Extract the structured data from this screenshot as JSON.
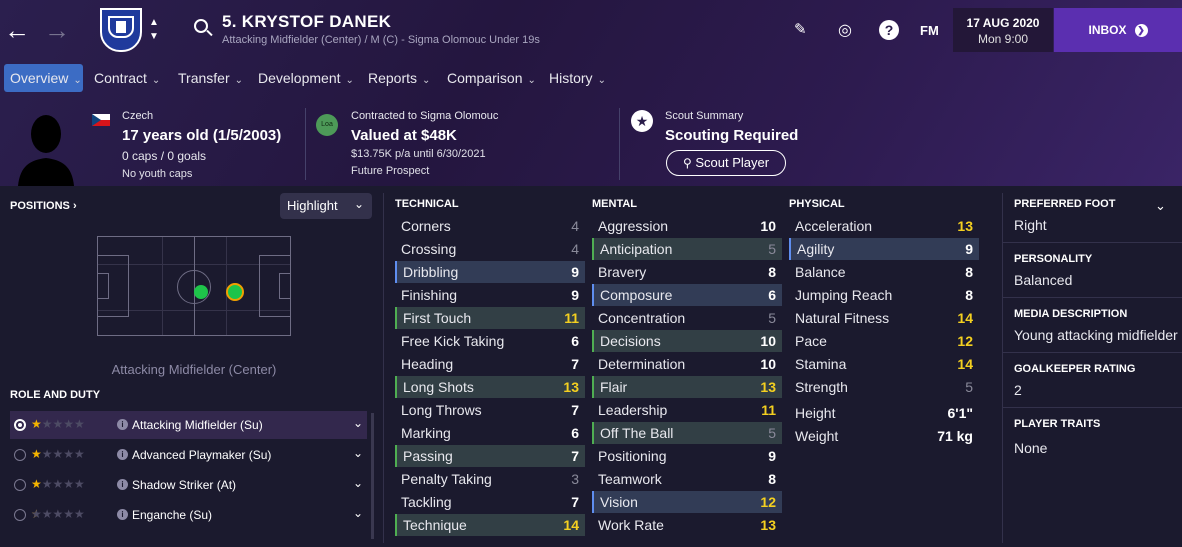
{
  "header": {
    "player_name": "5. KRYSTOF DANEK",
    "player_sub": "Attacking Midfielder (Center) / M (C) - Sigma Olomouc Under 19s",
    "brand": "FM",
    "date": "17 AUG 2020",
    "time": "Mon 9:00",
    "inbox_label": "INBOX"
  },
  "tabs": [
    {
      "label": "Overview"
    },
    {
      "label": "Contract"
    },
    {
      "label": "Transfer"
    },
    {
      "label": "Development"
    },
    {
      "label": "Reports"
    },
    {
      "label": "Comparison"
    },
    {
      "label": "History"
    }
  ],
  "profile": {
    "nationality": "Czech",
    "age": "17 years old (1/5/2003)",
    "caps": "0 caps / 0 goals",
    "youth_caps": "No youth caps"
  },
  "contract": {
    "club_badge": "Loa",
    "line1": "Contracted to Sigma Olomouc",
    "value": "Valued at $48K",
    "wage": "$13.75K p/a until 6/30/2021",
    "status": "Future Prospect"
  },
  "scout": {
    "title": "Scout Summary",
    "status": "Scouting Required",
    "button": "Scout Player"
  },
  "positions": {
    "title": "POSITIONS",
    "highlight": "Highlight",
    "label": "Attacking Midfielder (Center)"
  },
  "roles": {
    "title": "ROLE AND DUTY",
    "items": [
      {
        "name": "Attacking Midfielder (Su)",
        "stars": 1
      },
      {
        "name": "Advanced Playmaker (Su)",
        "stars": 1
      },
      {
        "name": "Shadow Striker (At)",
        "stars": 1
      },
      {
        "name": "Enganche (Su)",
        "stars": 0.5
      }
    ]
  },
  "technical": {
    "title": "TECHNICAL",
    "rows": [
      {
        "name": "Corners",
        "value": "4"
      },
      {
        "name": "Crossing",
        "value": "4"
      },
      {
        "name": "Dribbling",
        "value": "9"
      },
      {
        "name": "Finishing",
        "value": "9"
      },
      {
        "name": "First Touch",
        "value": "11"
      },
      {
        "name": "Free Kick Taking",
        "value": "6"
      },
      {
        "name": "Heading",
        "value": "7"
      },
      {
        "name": "Long Shots",
        "value": "13"
      },
      {
        "name": "Long Throws",
        "value": "7"
      },
      {
        "name": "Marking",
        "value": "6"
      },
      {
        "name": "Passing",
        "value": "7"
      },
      {
        "name": "Penalty Taking",
        "value": "3"
      },
      {
        "name": "Tackling",
        "value": "7"
      },
      {
        "name": "Technique",
        "value": "14"
      }
    ]
  },
  "mental": {
    "title": "MENTAL",
    "rows": [
      {
        "name": "Aggression",
        "value": "10"
      },
      {
        "name": "Anticipation",
        "value": "5"
      },
      {
        "name": "Bravery",
        "value": "8"
      },
      {
        "name": "Composure",
        "value": "6"
      },
      {
        "name": "Concentration",
        "value": "5"
      },
      {
        "name": "Decisions",
        "value": "10"
      },
      {
        "name": "Determination",
        "value": "10"
      },
      {
        "name": "Flair",
        "value": "13"
      },
      {
        "name": "Leadership",
        "value": "11"
      },
      {
        "name": "Off The Ball",
        "value": "5"
      },
      {
        "name": "Positioning",
        "value": "9"
      },
      {
        "name": "Teamwork",
        "value": "8"
      },
      {
        "name": "Vision",
        "value": "12"
      },
      {
        "name": "Work Rate",
        "value": "13"
      }
    ]
  },
  "physical": {
    "title": "PHYSICAL",
    "rows": [
      {
        "name": "Acceleration",
        "value": "13"
      },
      {
        "name": "Agility",
        "value": "9"
      },
      {
        "name": "Balance",
        "value": "8"
      },
      {
        "name": "Jumping Reach",
        "value": "8"
      },
      {
        "name": "Natural Fitness",
        "value": "14"
      },
      {
        "name": "Pace",
        "value": "12"
      },
      {
        "name": "Stamina",
        "value": "14"
      },
      {
        "name": "Strength",
        "value": "5"
      }
    ],
    "height_label": "Height",
    "height": "6'1\"",
    "weight_label": "Weight",
    "weight": "71 kg"
  },
  "details": {
    "preferred_foot_label": "PREFERRED FOOT",
    "preferred_foot": "Right",
    "personality_label": "PERSONALITY",
    "personality": "Balanced",
    "media_label": "MEDIA DESCRIPTION",
    "media": "Young attacking midfielder",
    "gk_label": "GOALKEEPER RATING",
    "gk": "2",
    "traits_label": "PLAYER TRAITS",
    "traits": "None"
  },
  "colors": {
    "accent": "#5b2fb0",
    "tab_active": "#3c6cc4",
    "attr_high": "#f4d020",
    "attr_low": "#8a8a9a",
    "position_dot": "#1ec44a"
  }
}
